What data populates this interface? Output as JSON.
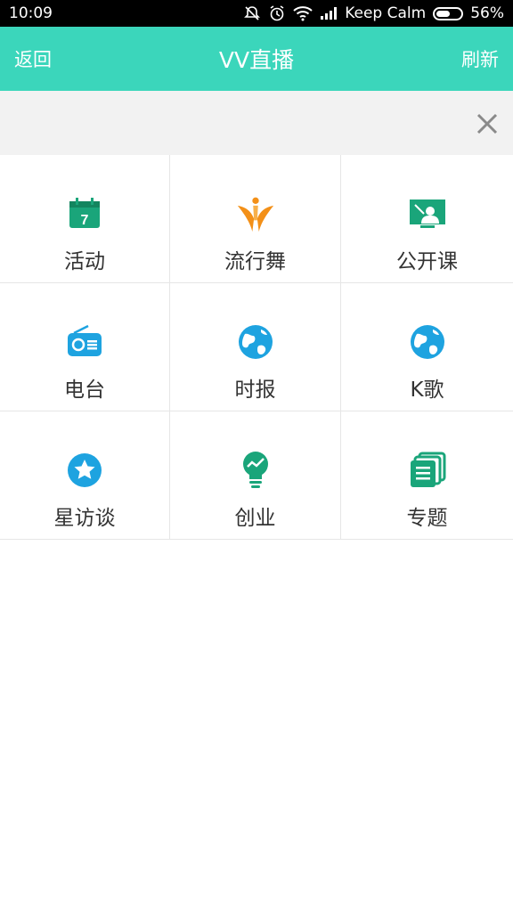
{
  "status_bar": {
    "time": "10:09",
    "carrier": "Keep Calm",
    "battery_percent": "56%",
    "battery_level": 0.56
  },
  "header": {
    "back_label": "返回",
    "title": "VV直播",
    "refresh_label": "刷新"
  },
  "grid": {
    "items": [
      {
        "label": "活动",
        "icon": "calendar-icon"
      },
      {
        "label": "流行舞",
        "icon": "dancer-icon"
      },
      {
        "label": "公开课",
        "icon": "classroom-icon"
      },
      {
        "label": "电台",
        "icon": "radio-icon"
      },
      {
        "label": "时报",
        "icon": "globe-icon"
      },
      {
        "label": "K歌",
        "icon": "globe-icon"
      },
      {
        "label": "星访谈",
        "icon": "star-icon"
      },
      {
        "label": "创业",
        "icon": "lightbulb-icon"
      },
      {
        "label": "专题",
        "icon": "documents-icon"
      }
    ]
  },
  "colors": {
    "header": "#3bd6bb",
    "green": "#1aa57a",
    "blue": "#1ea3e0",
    "orange": "#f39018"
  }
}
